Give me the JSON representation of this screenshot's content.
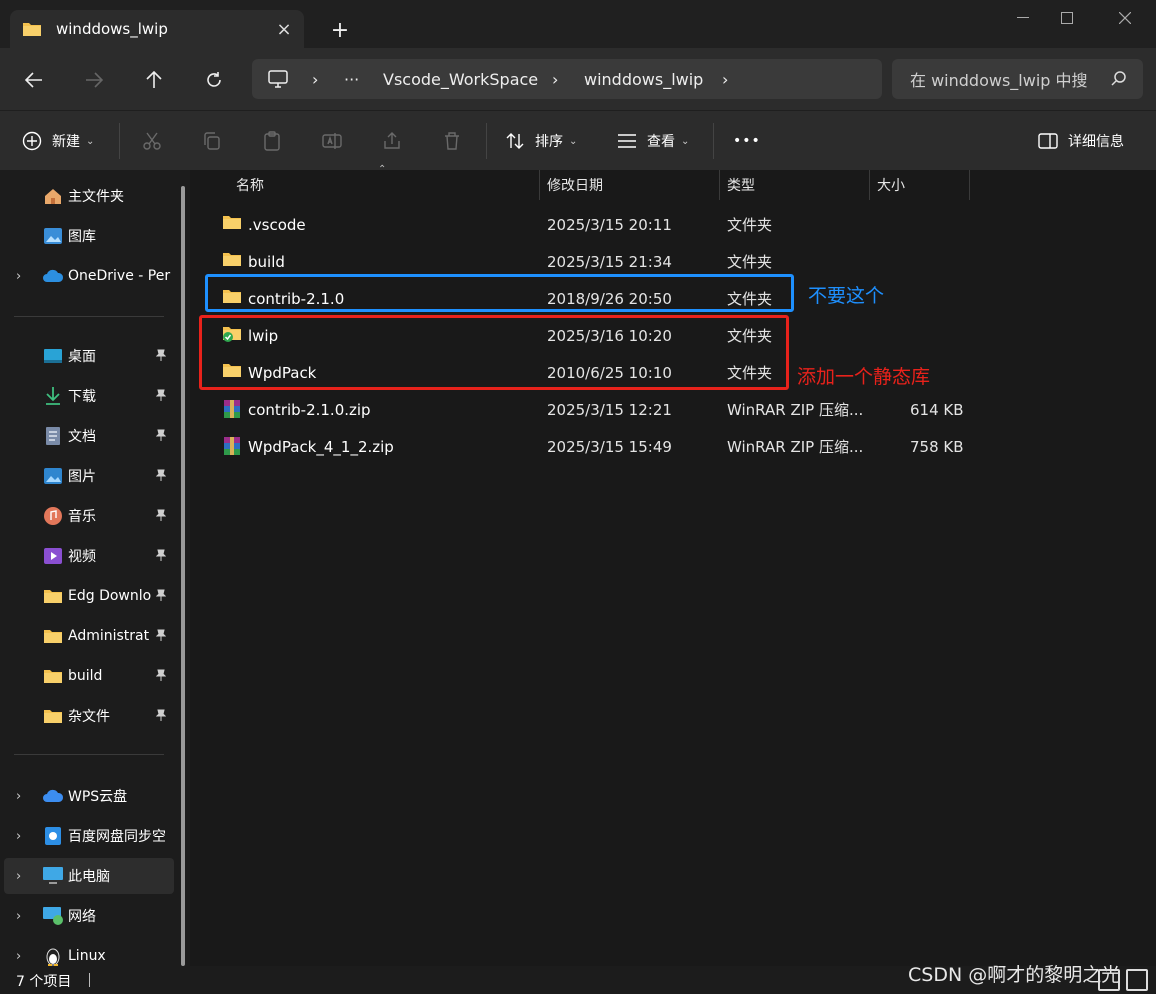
{
  "window": {
    "tab_title": "winddows_lwip",
    "tab_icon": "folder-icon",
    "new_tab_label": "+",
    "close_tab_glyph": "×",
    "minimize_glyph": "—",
    "maximize_glyph": "☐",
    "close_glyph": "✕"
  },
  "address": {
    "overflow_label": "···",
    "breadcrumbs": [
      "Vscode_WorkSpace",
      "winddows_lwip"
    ],
    "separator": "›"
  },
  "search": {
    "placeholder": "在 winddows_lwip 中搜"
  },
  "toolbar": {
    "new_label": "新建",
    "sort_label": "排序",
    "view_label": "查看",
    "more_label": "•••",
    "details_label": "详细信息",
    "caret": "⌄"
  },
  "sidebar": {
    "items": [
      {
        "label": "主文件夹",
        "icon": "home-icon",
        "pinned": false,
        "expand": false
      },
      {
        "label": "图库",
        "icon": "gallery-icon",
        "pinned": false,
        "expand": false
      },
      {
        "label": "OneDrive - Per",
        "icon": "onedrive-cloud-icon",
        "pinned": false,
        "expand": true
      },
      {
        "label": "桌面",
        "icon": "desktop-icon",
        "pinned": true,
        "expand": false
      },
      {
        "label": "下载",
        "icon": "download-icon",
        "pinned": true,
        "expand": false
      },
      {
        "label": "文档",
        "icon": "documents-icon",
        "pinned": true,
        "expand": false
      },
      {
        "label": "图片",
        "icon": "pictures-icon",
        "pinned": true,
        "expand": false
      },
      {
        "label": "音乐",
        "icon": "music-icon",
        "pinned": true,
        "expand": false
      },
      {
        "label": "视频",
        "icon": "videos-icon",
        "pinned": true,
        "expand": false
      },
      {
        "label": "Edg Downlo",
        "icon": "folder-icon",
        "pinned": true,
        "expand": false
      },
      {
        "label": "Administrat",
        "icon": "folder-icon",
        "pinned": true,
        "expand": false
      },
      {
        "label": "build",
        "icon": "folder-icon",
        "pinned": true,
        "expand": false
      },
      {
        "label": "杂文件",
        "icon": "folder-icon",
        "pinned": true,
        "expand": false
      },
      {
        "label": "WPS云盘",
        "icon": "wps-cloud-icon",
        "pinned": false,
        "expand": true
      },
      {
        "label": "百度网盘同步空",
        "icon": "baidu-netdisk-icon",
        "pinned": false,
        "expand": true
      },
      {
        "label": "此电脑",
        "icon": "this-pc-icon",
        "pinned": false,
        "expand": true,
        "selected": true
      },
      {
        "label": "网络",
        "icon": "network-icon",
        "pinned": false,
        "expand": true
      },
      {
        "label": "Linux",
        "icon": "linux-penguin-icon",
        "pinned": false,
        "expand": true
      }
    ],
    "expand_glyph": "›",
    "pin_glyph": "📌"
  },
  "columns": {
    "name": "名称",
    "modified": "修改日期",
    "type": "类型",
    "size": "大小"
  },
  "files": [
    {
      "name": ".vscode",
      "modified": "2025/3/15 20:11",
      "type": "文件夹",
      "size": "",
      "icon": "folder-icon"
    },
    {
      "name": "build",
      "modified": "2025/3/15 21:34",
      "type": "文件夹",
      "size": "",
      "icon": "folder-icon"
    },
    {
      "name": "contrib-2.1.0",
      "modified": "2018/9/26 20:50",
      "type": "文件夹",
      "size": "",
      "icon": "folder-icon"
    },
    {
      "name": "lwip",
      "modified": "2025/3/16 10:20",
      "type": "文件夹",
      "size": "",
      "icon": "folder-synced-icon"
    },
    {
      "name": "WpdPack",
      "modified": "2010/6/25 10:10",
      "type": "文件夹",
      "size": "",
      "icon": "folder-icon"
    },
    {
      "name": "contrib-2.1.0.zip",
      "modified": "2025/3/15 12:21",
      "type": "WinRAR ZIP 压缩...",
      "size": "614 KB",
      "icon": "winrar-archive-icon"
    },
    {
      "name": "WpdPack_4_1_2.zip",
      "modified": "2025/3/15 15:49",
      "type": "WinRAR ZIP 压缩...",
      "size": "758 KB",
      "icon": "winrar-archive-icon"
    }
  ],
  "annotations": {
    "blue_note": "不要这个",
    "red_note": "添加一个静态库",
    "blue_color": "#1e90ff",
    "red_color": "#e8221b"
  },
  "status": {
    "item_count": "7 个项目",
    "watermark": "CSDN @啊才的黎明之光"
  },
  "colors": {
    "background": "#191919",
    "chrome": "#2c2c2c",
    "folder": "#f4c14e"
  }
}
